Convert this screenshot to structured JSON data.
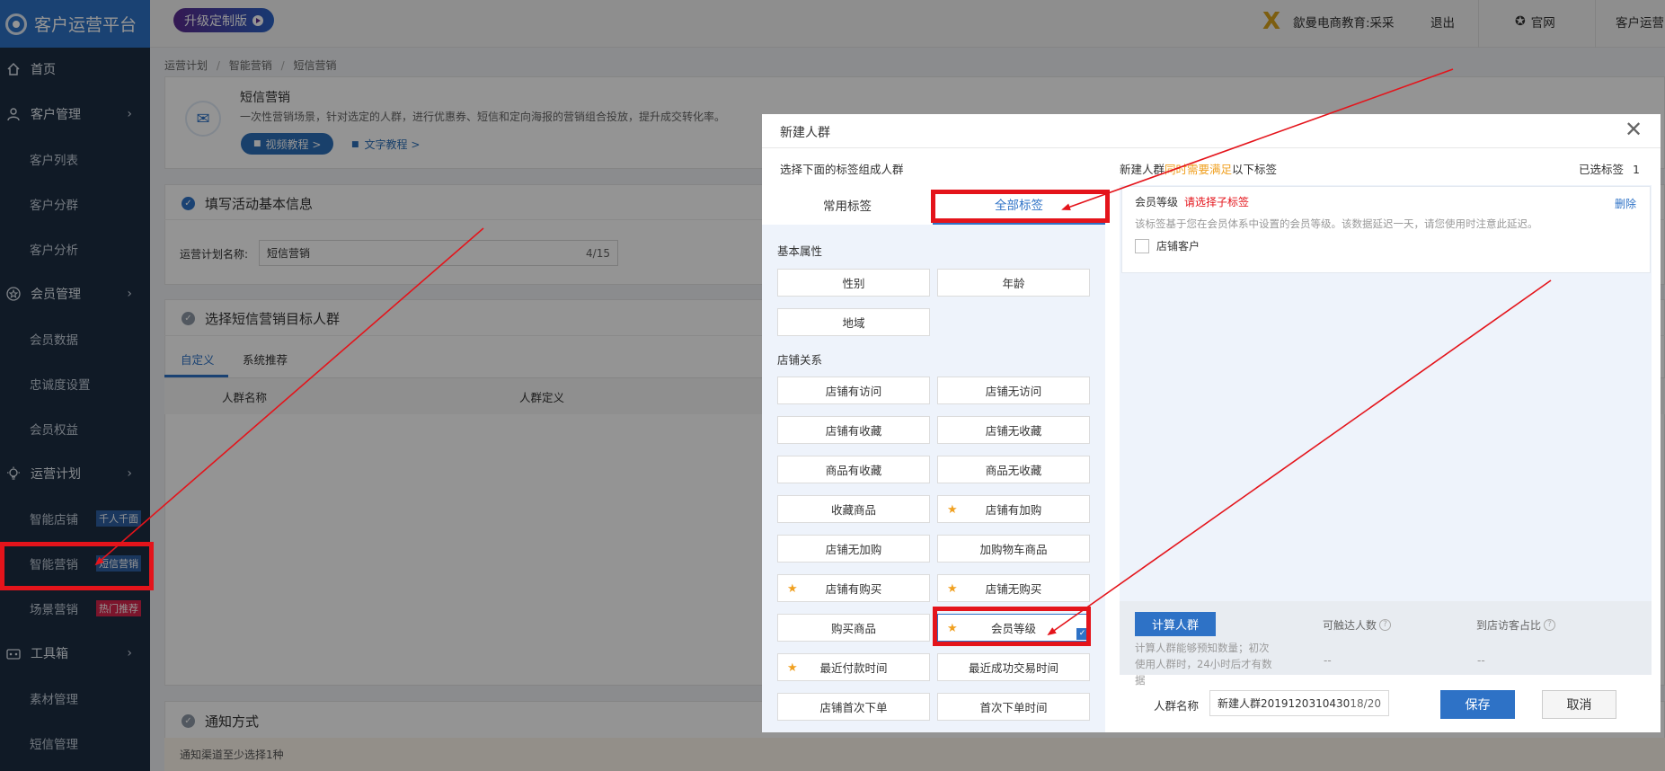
{
  "app": {
    "title": "客户运营平台"
  },
  "sidebar": {
    "items": [
      {
        "label": "首页"
      },
      {
        "label": "客户管理"
      },
      {
        "label": "客户列表"
      },
      {
        "label": "客户分群"
      },
      {
        "label": "客户分析"
      },
      {
        "label": "会员管理"
      },
      {
        "label": "会员数据"
      },
      {
        "label": "忠诚度设置"
      },
      {
        "label": "会员权益"
      },
      {
        "label": "运营计划"
      },
      {
        "label": "智能店铺",
        "tag": "千人千面"
      },
      {
        "label": "智能营销",
        "tag": "短信营销"
      },
      {
        "label": "场景营销",
        "tag": "热门推荐"
      },
      {
        "label": "工具箱"
      },
      {
        "label": "素材管理"
      },
      {
        "label": "短信管理"
      }
    ]
  },
  "topbar": {
    "upgrade_label": "升级定制版",
    "user_label": "歙曼电商教育:采采",
    "logout_label": "退出",
    "official_label": "官网",
    "platform_label": "客户运营"
  },
  "breadcrumb": {
    "items": [
      "运营计划",
      "智能营销",
      "短信营销"
    ]
  },
  "intro": {
    "title": "短信营销",
    "desc": "一次性营销场景，针对选定的人群，进行优惠券、短信和定向海报的营销组合投放，提升成交转化率。",
    "video_label": "视频教程 >",
    "text_label": "文字教程 >"
  },
  "section1": {
    "title": "填写活动基本信息",
    "name_label": "运营计划名称:",
    "name_value": "短信营销",
    "name_count": "4/15"
  },
  "section2": {
    "title": "选择短信营销目标人群",
    "tabs": [
      "自定义",
      "系统推荐"
    ],
    "columns": [
      "人群名称",
      "人群定义"
    ]
  },
  "section3": {
    "title": "通知方式",
    "hint": "通知渠道至少选择1种"
  },
  "modal": {
    "title": "新建人群",
    "left_hint": "选择下面的标签组成人群",
    "right_hint_pre": "新建人群",
    "right_hint_em": "同时需要满足",
    "right_hint_post": "以下标签",
    "selected_label": "已选标签",
    "selected_count": "1",
    "tabs": [
      "常用标签",
      "全部标签"
    ],
    "groups": [
      {
        "label": "基本属性",
        "tags": [
          "性别",
          "年龄",
          "地域"
        ]
      },
      {
        "label": "店铺关系",
        "tags": [
          "店铺有访问",
          "店铺无访问",
          "店铺有收藏",
          "店铺无收藏",
          "商品有收藏",
          "商品无收藏",
          "收藏商品",
          "店铺有加购",
          "店铺无加购",
          "加购物车商品",
          "店铺有购买",
          "店铺无购买",
          "购买商品",
          "会员等级",
          "最近付款时间",
          "最近成功交易时间",
          "店铺首次下单",
          "首次下单时间"
        ]
      }
    ],
    "selected_tag": {
      "name": "会员等级",
      "warn": "请选择子标签",
      "delete": "删除",
      "desc": "该标签基于您在会员体系中设置的会员等级。该数据延迟一天，请您使用时注意此延迟。",
      "option": "店铺客户"
    },
    "calc": {
      "button": "计算人群",
      "desc": "计算人群能够预知数量；初次使用人群时，24小时后才有数据",
      "reach_label": "可触达人数",
      "reach_value": "--",
      "ratio_label": "到店访客占比",
      "ratio_value": "--"
    },
    "name_label": "人群名称",
    "name_value": "新建人群20191203104306",
    "name_count": "18/20",
    "save": "保存",
    "cancel": "取消"
  },
  "colors": {
    "accent": "#2e72c6",
    "highlight": "#e4141b",
    "sidebar": "#1c2d42"
  }
}
